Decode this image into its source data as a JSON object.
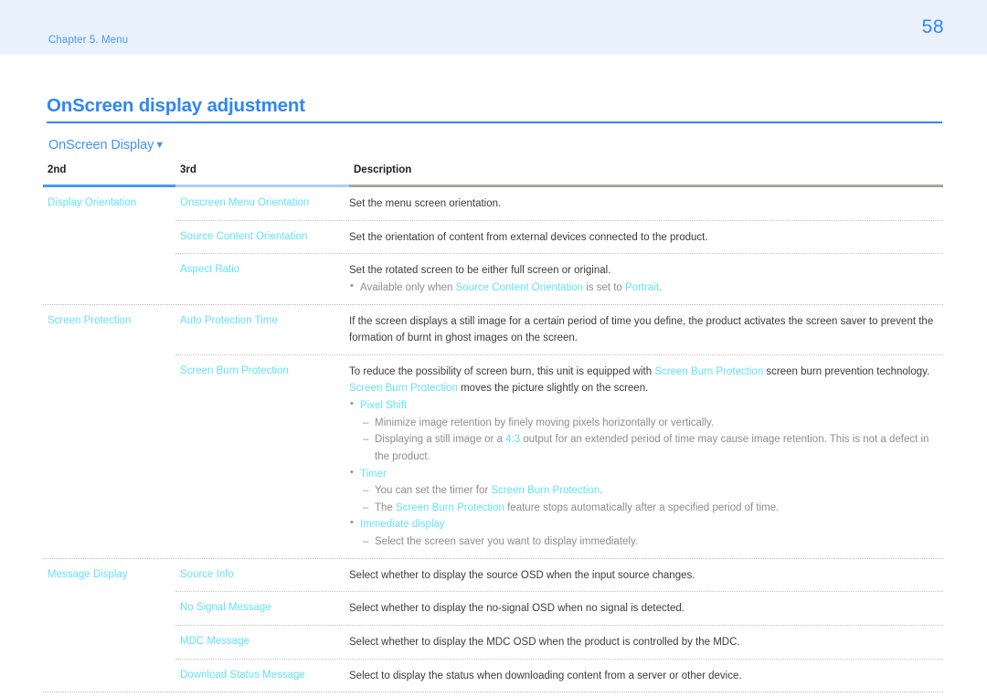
{
  "header": {
    "chapter": "Chapter 5. Menu",
    "page_number": "58",
    "banner_color": "#e8f1fc"
  },
  "title": {
    "heading": "OnScreen display adjustment",
    "rule_color": "#2f86f6"
  },
  "section": {
    "label": "OnScreen Display",
    "caret": "▼"
  },
  "table": {
    "columns": {
      "second": "2nd",
      "third": "3rd",
      "description": "Description"
    },
    "groups": [
      {
        "label": "Display Orientation",
        "rows": [
          {
            "third": "Onscreen Menu Orientation",
            "desc_line1": "Set the menu screen orientation."
          },
          {
            "third": "Source Content Orientation",
            "desc_line1": "Set the orientation of content from external devices connected to the product."
          },
          {
            "third": "Aspect Ratio",
            "desc_line1": "Set the rotated screen to be either full screen or original.",
            "bullet_pre": "Available only when ",
            "bullet_hl1": "Source Content Orientation",
            "bullet_mid": " is set to ",
            "bullet_hl2": "Portrait",
            "bullet_post": "."
          }
        ]
      },
      {
        "label": "Screen Protection",
        "rows": [
          {
            "third": "Auto Protection Time",
            "desc_line1": "If the screen displays a still image for a certain period of time you define, the product activates the screen saver to prevent the formation of burnt in ghost images on the screen."
          },
          {
            "third": "Screen Burn Protection",
            "p1_pre": "To reduce the possibility of screen burn, this unit is equipped with ",
            "p1_hl": "Screen Burn Protection",
            "p1_post": " screen burn prevention technology.",
            "p2_hl": "Screen Burn Protection",
            "p2_post": " moves the picture slightly on the screen.",
            "b1_label": "Pixel Shift",
            "b1_d1": "Minimize image retention by finely moving pixels horizontally or vertically.",
            "b1_d2_pre": "Displaying a still image or a ",
            "b1_d2_hl": "4:3",
            "b1_d2_post": " output for an extended period of time may cause image retention. This is not a defect in the product.",
            "b2_label": "Timer",
            "b2_d1_pre": "You can set the timer for ",
            "b2_d1_hl": "Screen Burn Protection",
            "b2_d1_post": ".",
            "b2_d2_pre": "The ",
            "b2_d2_hl": "Screen Burn Protection",
            "b2_d2_post": " feature stops automatically after a specified period of time.",
            "b3_label": "Immediate display",
            "b3_d1": "Select the screen saver you want to display immediately."
          }
        ]
      },
      {
        "label": "Message Display",
        "rows": [
          {
            "third": "Source Info",
            "desc_line1": "Select whether to display the source OSD when the input source changes."
          },
          {
            "third": "No Signal Message",
            "desc_line1": "Select whether to display the no-signal OSD when no signal is detected."
          },
          {
            "third": "MDC Message",
            "desc_line1": "Select whether to display the MDC OSD when the product is controlled by the MDC."
          },
          {
            "third": "Download Status Message",
            "desc_line1": "Select to display the status when downloading content from a server or other device."
          }
        ]
      }
    ]
  },
  "colors": {
    "accent_blue": "#2f86f6",
    "link_cyan": "#64e2f8",
    "body_text": "#3c3c3c",
    "muted_text": "#8d8d8d"
  }
}
